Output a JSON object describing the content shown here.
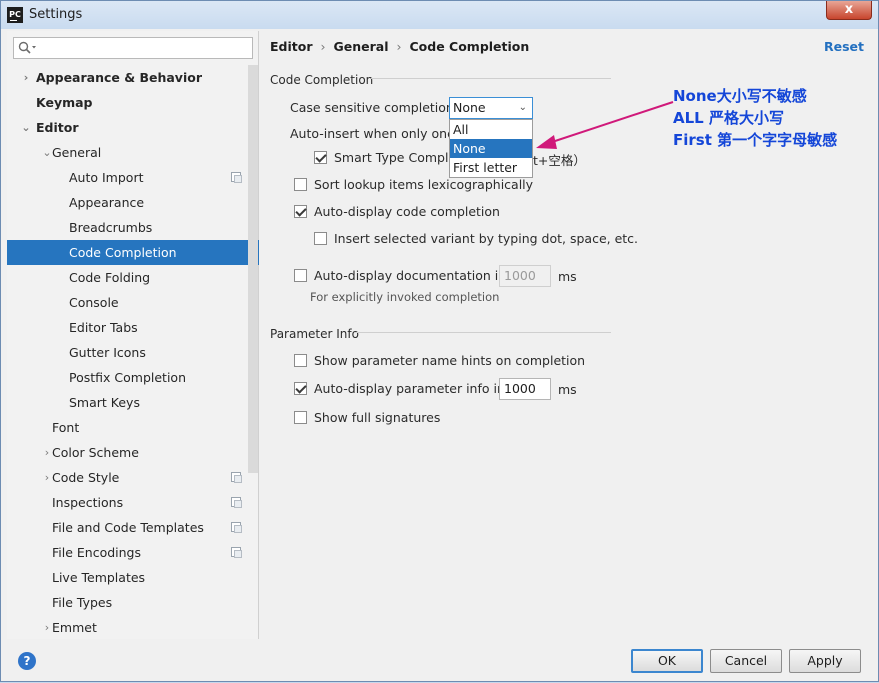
{
  "window": {
    "title": "Settings",
    "app_icon": "PC",
    "close_symbol": "x"
  },
  "sidebar": {
    "search_placeholder": "",
    "items": [
      {
        "label": "Appearance & Behavior",
        "level": 0,
        "arrow": "›",
        "bold": true
      },
      {
        "label": "Keymap",
        "level": 0,
        "arrow": "",
        "bold": true
      },
      {
        "label": "Editor",
        "level": 0,
        "arrow": "⌄",
        "bold": true
      },
      {
        "label": "General",
        "level": 1,
        "arrow": "⌄"
      },
      {
        "label": "Auto Import",
        "level": 2,
        "icon": true
      },
      {
        "label": "Appearance",
        "level": 2
      },
      {
        "label": "Breadcrumbs",
        "level": 2
      },
      {
        "label": "Code Completion",
        "level": 2,
        "selected": true
      },
      {
        "label": "Code Folding",
        "level": 2
      },
      {
        "label": "Console",
        "level": 2
      },
      {
        "label": "Editor Tabs",
        "level": 2
      },
      {
        "label": "Gutter Icons",
        "level": 2
      },
      {
        "label": "Postfix Completion",
        "level": 2
      },
      {
        "label": "Smart Keys",
        "level": 2
      },
      {
        "label": "Font",
        "level": 1
      },
      {
        "label": "Color Scheme",
        "level": 1,
        "arrow": "›"
      },
      {
        "label": "Code Style",
        "level": 1,
        "arrow": "›",
        "icon": true
      },
      {
        "label": "Inspections",
        "level": 1,
        "icon": true
      },
      {
        "label": "File and Code Templates",
        "level": 1,
        "icon": true
      },
      {
        "label": "File Encodings",
        "level": 1,
        "icon": true
      },
      {
        "label": "Live Templates",
        "level": 1
      },
      {
        "label": "File Types",
        "level": 1
      },
      {
        "label": "Emmet",
        "level": 1,
        "arrow": "›"
      }
    ]
  },
  "breadcrumb": [
    "Editor",
    "General",
    "Code Completion"
  ],
  "reset_label": "Reset",
  "code_completion": {
    "group_title": "Code Completion",
    "case_label": "Case sensitive completion:",
    "case_value": "None",
    "case_options": [
      "All",
      "None",
      "First letter"
    ],
    "auto_insert_label": "Auto-insert when only one c",
    "smart_type_label": "Smart Type Comple",
    "smart_type_suffix": "t+空格）",
    "sort_lookup_label": "Sort lookup items lexicographically",
    "auto_display_label": "Auto-display code completion",
    "insert_selected_label": "Insert selected variant by typing dot, space, etc.",
    "auto_doc_label": "Auto-display documentation in",
    "auto_doc_value": "1000",
    "auto_doc_unit": "ms",
    "auto_doc_hint": "For explicitly invoked completion",
    "checked": {
      "smart_type": true,
      "sort_lookup": false,
      "auto_display": true,
      "insert_selected": false,
      "auto_doc": false
    }
  },
  "parameter_info": {
    "group_title": "Parameter Info",
    "show_hints_label": "Show parameter name hints on completion",
    "auto_param_label": "Auto-display parameter info in",
    "auto_param_value": "1000",
    "auto_param_unit": "ms",
    "full_sig_label": "Show full signatures",
    "checked": {
      "show_hints": false,
      "auto_param": true,
      "full_sig": false
    }
  },
  "annotation": {
    "lines": [
      "None大小写不敏感",
      "ALL 严格大小写",
      "First 第一个字字母敏感"
    ],
    "color": "#1446d8",
    "arrow_color": "#d0197a"
  },
  "footer": {
    "help": "?",
    "ok": "OK",
    "cancel": "Cancel",
    "apply": "Apply"
  }
}
